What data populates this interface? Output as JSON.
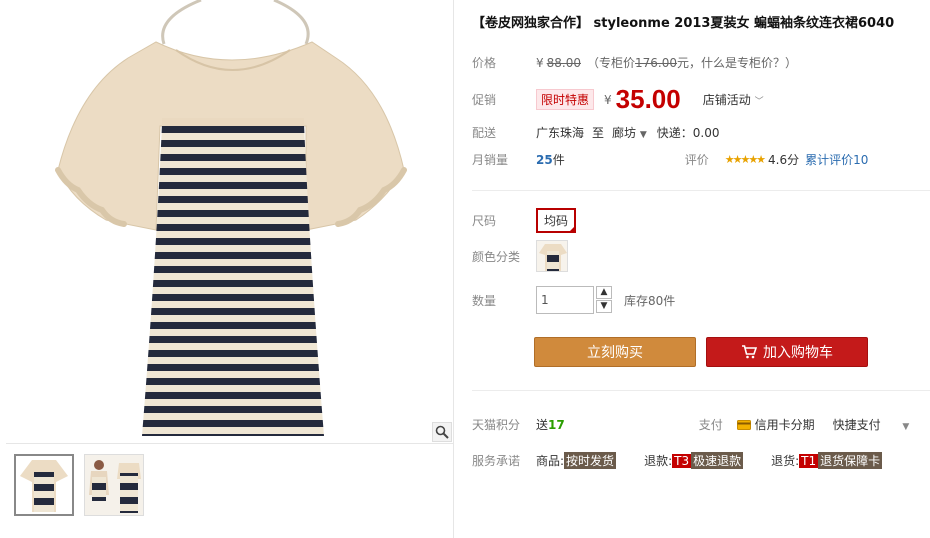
{
  "title": "【卷皮网独家合作】 styleonme 2013夏装女 蝙蝠袖条纹连衣裙6040",
  "price": {
    "label": "价格",
    "currency": "¥",
    "original": "88.00",
    "counter_prefix": "（专柜价",
    "counter_value": "176.00",
    "counter_suffix": "元，什么是专柜价？）"
  },
  "promo": {
    "label": "促销",
    "tag": "限时特惠",
    "currency": "¥",
    "value": "35.00",
    "activity": "店铺活动"
  },
  "shipping": {
    "label": "配送",
    "from": "广东珠海",
    "to_word": "至",
    "to": "廊坊",
    "express": "快递：0.00"
  },
  "sales": {
    "label": "月销量",
    "count": "25",
    "unit": "件",
    "rating_label": "评价",
    "score": "4.6分",
    "reviews": "累计评价10",
    "stars": "★★★★★"
  },
  "size": {
    "label": "尺码",
    "option": "均码"
  },
  "color": {
    "label": "颜色分类"
  },
  "quantity": {
    "label": "数量",
    "value": "1",
    "stock": "库存80件"
  },
  "buttons": {
    "buy": "立刻购买",
    "cart": "加入购物车"
  },
  "points": {
    "label": "天猫积分",
    "prefix": "送",
    "value": "17"
  },
  "pay": {
    "label": "支付",
    "credit": "信用卡分期",
    "quick": "快捷支付"
  },
  "service": {
    "label": "服务承诺",
    "goods_label": "商品:",
    "goods_tag": "按时发货",
    "refund_label": "退款:",
    "refund_code": "T3",
    "refund_tag": "极速退款",
    "return_label": "退货:",
    "return_code": "T1",
    "return_tag": "退货保障卡"
  },
  "colors": {
    "price_red": "#c40000",
    "buy_orange": "#d08a3c",
    "cart_red": "#c41a1a"
  },
  "icons": [
    "zoom-icon",
    "chevron-down-icon",
    "cart-icon",
    "credit-card-icon",
    "caret-down-icon"
  ]
}
